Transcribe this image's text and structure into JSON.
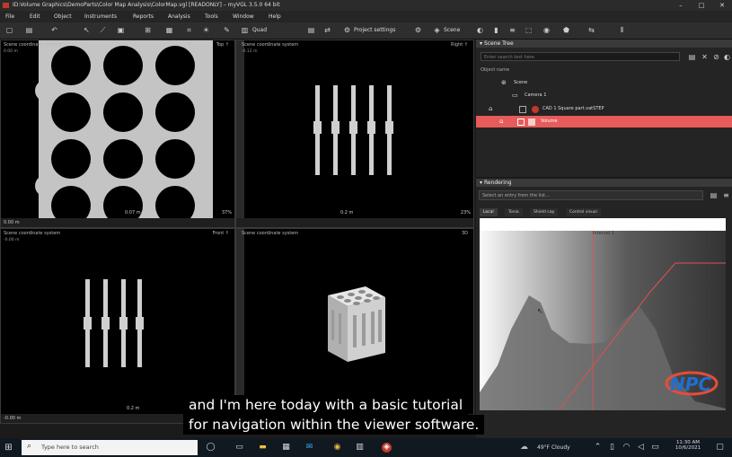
{
  "window": {
    "title": "ID:Volume Graphics\\DemoParts\\Color Map Analysis\\ColorMap.vgl [READONLY] – myVGL 3.5.0 64 bit",
    "controls": [
      "–",
      "□",
      "✕"
    ]
  },
  "menu": [
    "File",
    "Edit",
    "Object",
    "Instruments",
    "Reports",
    "Analysis",
    "Tools",
    "Window",
    "Help"
  ],
  "toolbar": {
    "layout_label": "Quad",
    "project_settings": "Project settings",
    "scene_label": "Scene"
  },
  "viewports": {
    "top_left": {
      "label": "Scene coordinate system",
      "sub": "0.00 m",
      "view": "Top ↑",
      "scale": "0.07 m",
      "zoom": "37%",
      "footer": "0.00 m"
    },
    "top_right": {
      "label": "Scene coordinate system",
      "sub": "-0.12 m",
      "view": "Right ↑",
      "scale": "0.2 m",
      "zoom": "23%"
    },
    "bottom_left": {
      "label": "Scene coordinate system",
      "sub": "-0.00 m",
      "view": "Front ↑",
      "scale": "0.2 m",
      "footer": "-0.00 m"
    },
    "bottom_right": {
      "label": "Scene coordinate system",
      "view": "3D"
    }
  },
  "scene_tree": {
    "title": "Scene Tree",
    "search_placeholder": "Enter search text here",
    "column_header": "Object name",
    "items": [
      {
        "label": "Scene"
      },
      {
        "label": "Camera 1"
      },
      {
        "label": "CAD 1 Square part.vatSTEP"
      },
      {
        "label": "Volume"
      }
    ]
  },
  "rendering": {
    "title": "Rendering",
    "dropdown": "Select an entry from the list...",
    "tabs": [
      "Local",
      "Tonia",
      "Shield cap",
      "Control visual"
    ],
    "interval_label": "Interval 1"
  },
  "caption": {
    "line1": "and I'm here today with a basic tutorial",
    "line2": "for navigation within the viewer software."
  },
  "taskbar": {
    "search_placeholder": "Type here to search",
    "weather": "49°F  Cloudy",
    "time": "11:30 AM",
    "date": "10/6/2021"
  },
  "colors": {
    "accent_red": "#e05050",
    "selection": "#e85b5b",
    "material": "#bdbdbd"
  }
}
